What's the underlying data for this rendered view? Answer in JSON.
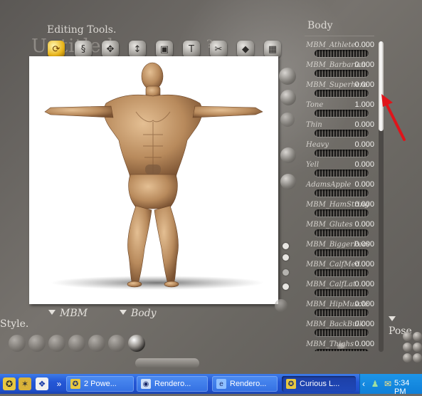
{
  "app": {
    "title_ghost": "Untitled",
    "editing_tools_title": "Editing Tools.",
    "help_mark": "?",
    "tools": [
      {
        "name": "rotate-tool-icon",
        "glyph": "⟳",
        "active": true
      },
      {
        "name": "twist-tool-icon",
        "glyph": "§",
        "active": false
      },
      {
        "name": "translate-tool-icon",
        "glyph": "✥",
        "active": false
      },
      {
        "name": "translate-in-out-tool-icon",
        "glyph": "↕",
        "active": false
      },
      {
        "name": "scale-tool-icon",
        "glyph": "▣",
        "active": false
      },
      {
        "name": "taper-tool-icon",
        "glyph": "T",
        "active": false
      },
      {
        "name": "chain-break-tool-icon",
        "glyph": "✂",
        "active": false
      },
      {
        "name": "color-tool-icon",
        "glyph": "◆",
        "active": false
      },
      {
        "name": "grouping-tool-icon",
        "glyph": "▦",
        "active": false
      }
    ],
    "figure_menu_label": "MBM",
    "body_part_menu_label": "Body",
    "style_title": "Style.",
    "pose_title": "Pose",
    "body_panel_title": "Body",
    "parameters": [
      {
        "label": "MBM_Athlete",
        "value": "0.000"
      },
      {
        "label": "MBM_Barbarian",
        "value": "0.000"
      },
      {
        "label": "MBM_Superhero",
        "value": "0.000"
      },
      {
        "label": "Tone",
        "value": "1.000"
      },
      {
        "label": "Thin",
        "value": "0.000"
      },
      {
        "label": "Heavy",
        "value": "0.000"
      },
      {
        "label": "Yell",
        "value": "0.000"
      },
      {
        "label": "AdamsApple",
        "value": "0.000"
      },
      {
        "label": "MBM_HamString",
        "value": "0.000"
      },
      {
        "label": "MBM_Glutes",
        "value": "0.000"
      },
      {
        "label": "MBM_BiggerPecs",
        "value": "0.000"
      },
      {
        "label": "MBM_CalfMed",
        "value": "0.000"
      },
      {
        "label": "MBM_CalfLat",
        "value": "0.000"
      },
      {
        "label": "MBM_HipMuscle",
        "value": "0.000"
      },
      {
        "label": "MBM_BackBulk",
        "value": "0.000"
      },
      {
        "label": "MBM_Thighs",
        "value": "0.000"
      }
    ],
    "scroll_position": 0.0
  },
  "taskbar": {
    "buttons": [
      {
        "label": "2 Powe...",
        "icon": "poser-icon",
        "pressed": false
      },
      {
        "label": "Rendero...",
        "icon": "browser-icon",
        "pressed": false
      },
      {
        "label": "Rendero...",
        "icon": "ie-icon",
        "pressed": false
      },
      {
        "label": "Curious L...",
        "icon": "poser-icon",
        "pressed": true
      }
    ],
    "clock": "5:34 PM"
  },
  "colors": {
    "annotation_arrow": "#e0141a",
    "taskbar_blue": "#2457d6",
    "active_tool": "#e8b318"
  }
}
